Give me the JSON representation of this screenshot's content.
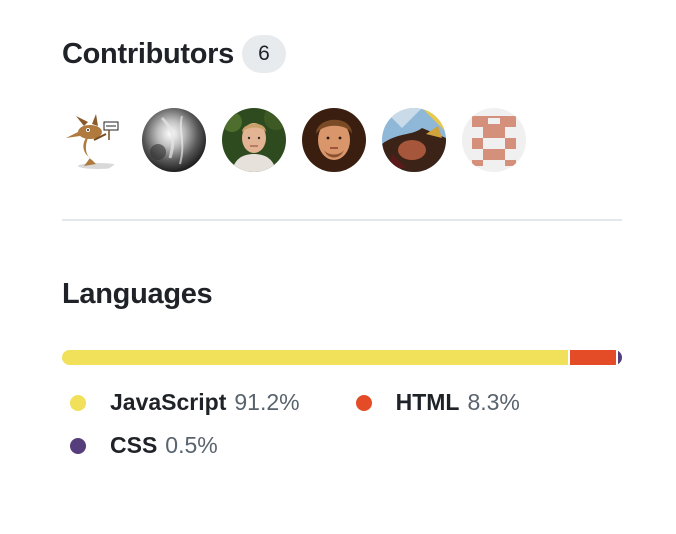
{
  "contributors": {
    "title": "Contributors",
    "count": "6",
    "avatars": [
      {
        "icon": "cartoon-coyote-avatar",
        "tooltip": ""
      },
      {
        "icon": "grayscale-photo-avatar",
        "tooltip": ""
      },
      {
        "icon": "person-green-background-avatar",
        "tooltip": ""
      },
      {
        "icon": "person-dark-background-avatar",
        "tooltip": ""
      },
      {
        "icon": "outdoor-photo-avatar",
        "tooltip": ""
      },
      {
        "icon": "identicon-avatar",
        "tooltip": ""
      }
    ]
  },
  "languages": {
    "title": "Languages",
    "items": [
      {
        "name": "JavaScript",
        "percent": "91.2%",
        "value": 91.2,
        "color": "#f1e05a"
      },
      {
        "name": "HTML",
        "percent": "8.3%",
        "value": 8.3,
        "color": "#e34c26"
      },
      {
        "name": "CSS",
        "percent": "0.5%",
        "value": 0.5,
        "color": "#563d7c"
      }
    ]
  }
}
